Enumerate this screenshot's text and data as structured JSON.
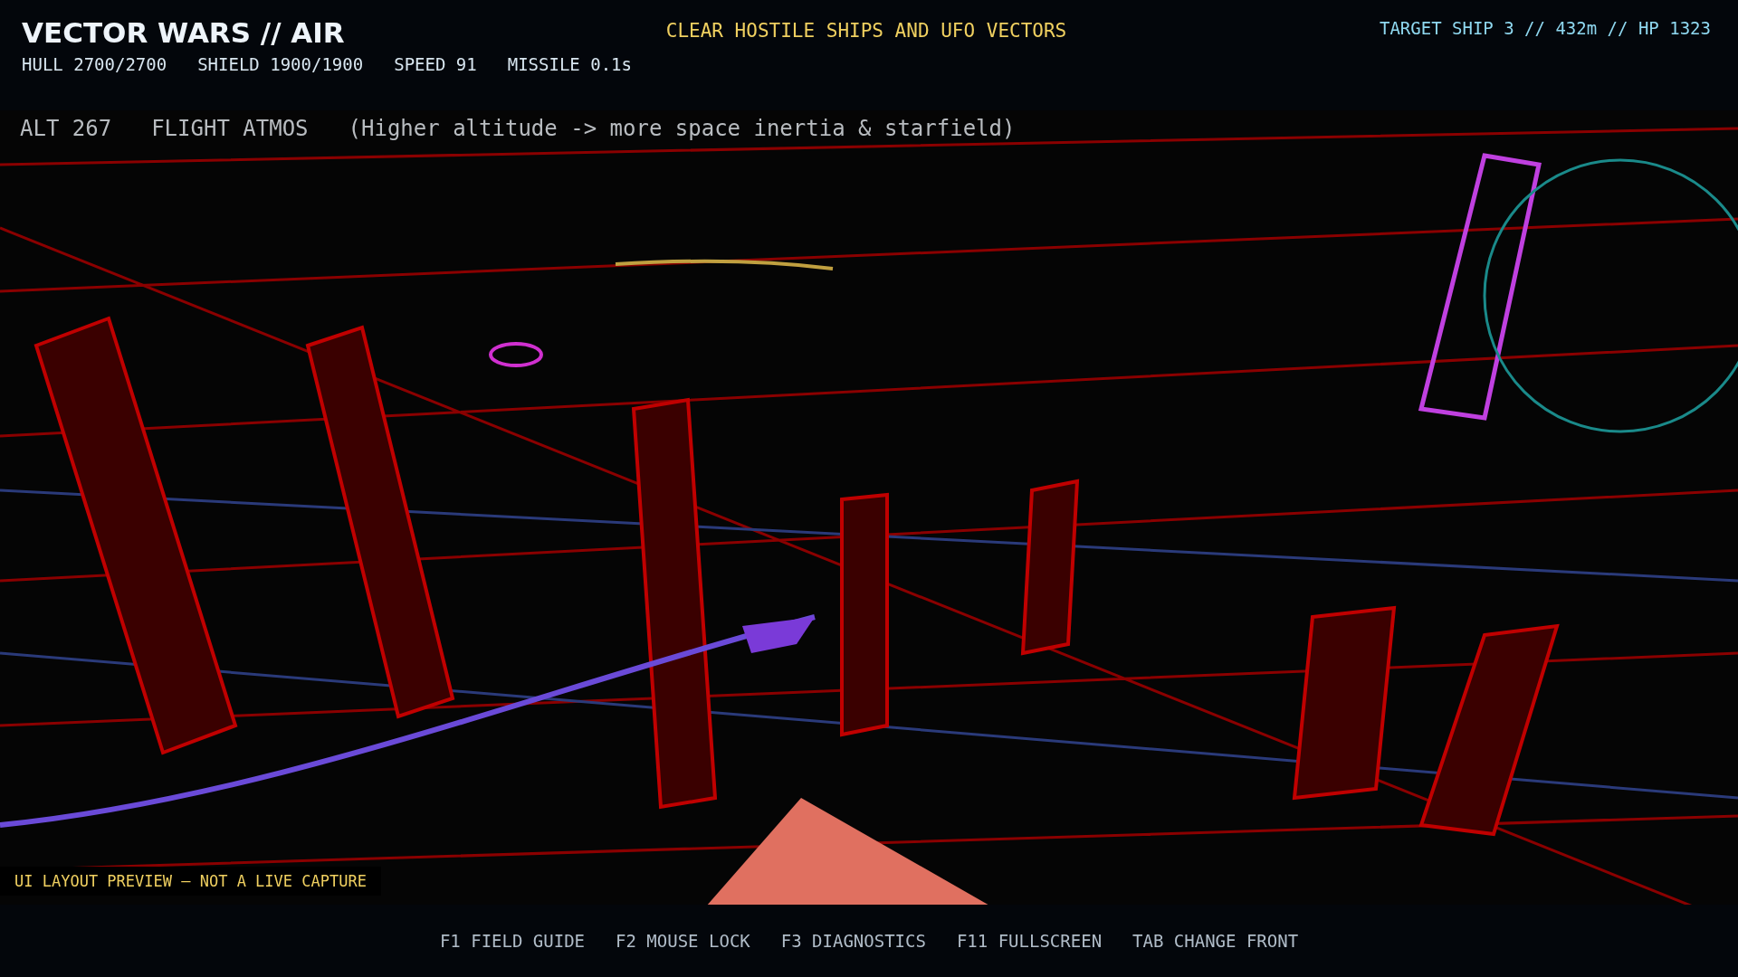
{
  "hud": {
    "title": "VECTOR WARS // AIR",
    "stats": [
      "HULL 2700/2700",
      "SHIELD 1900/1900",
      "SPEED 91",
      "MISSILE 0.1s"
    ],
    "objective": "CLEAR HOSTILE SHIPS AND UFO VECTORS",
    "target": "TARGET SHIP 3 // 432m // HP 1323"
  },
  "viewport": {
    "kind": "picture",
    "overlay": [
      "ALT 267",
      "FLIGHT ATMOS",
      "(Higher altitude -> more space inertia & starfield)"
    ],
    "preview_label": "UI LAYOUT PREVIEW — NOT A LIVE CAPTURE"
  },
  "hotkeys": [
    "F1 FIELD GUIDE",
    "F2 MOUSE LOCK",
    "F3 DIAGNOSTICS",
    "F11 FULLSCREEN",
    "TAB CHANGE FRONT"
  ]
}
